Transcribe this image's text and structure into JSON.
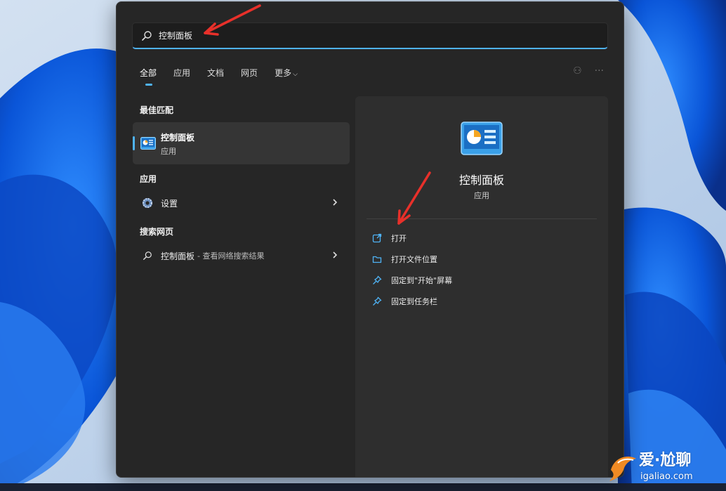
{
  "search": {
    "query": "控制面板"
  },
  "tabs": [
    {
      "label": "全部",
      "active": true
    },
    {
      "label": "应用"
    },
    {
      "label": "文档"
    },
    {
      "label": "网页"
    },
    {
      "label": "更多"
    }
  ],
  "sections": {
    "best_match": "最佳匹配",
    "apps": "应用",
    "web": "搜索网页"
  },
  "best_match": {
    "name": "控制面板",
    "type": "应用"
  },
  "apps": [
    {
      "label": "设置"
    }
  ],
  "web_results": [
    {
      "label": "控制面板",
      "sub": "- 查看网络搜索结果"
    }
  ],
  "detail": {
    "title": "控制面板",
    "subtitle": "应用",
    "actions": [
      {
        "label": "打开",
        "icon": "open-external-icon"
      },
      {
        "label": "打开文件位置",
        "icon": "folder-icon"
      },
      {
        "label": "固定到\"开始\"屏幕",
        "icon": "pin-icon"
      },
      {
        "label": "固定到任务栏",
        "icon": "pin-icon"
      }
    ]
  },
  "watermark": {
    "brand": "爱·尬聊",
    "url": "igaliao.com"
  },
  "colors": {
    "accent": "#4fb3f5",
    "panel": "#262626",
    "annotation": "#e8302a"
  }
}
